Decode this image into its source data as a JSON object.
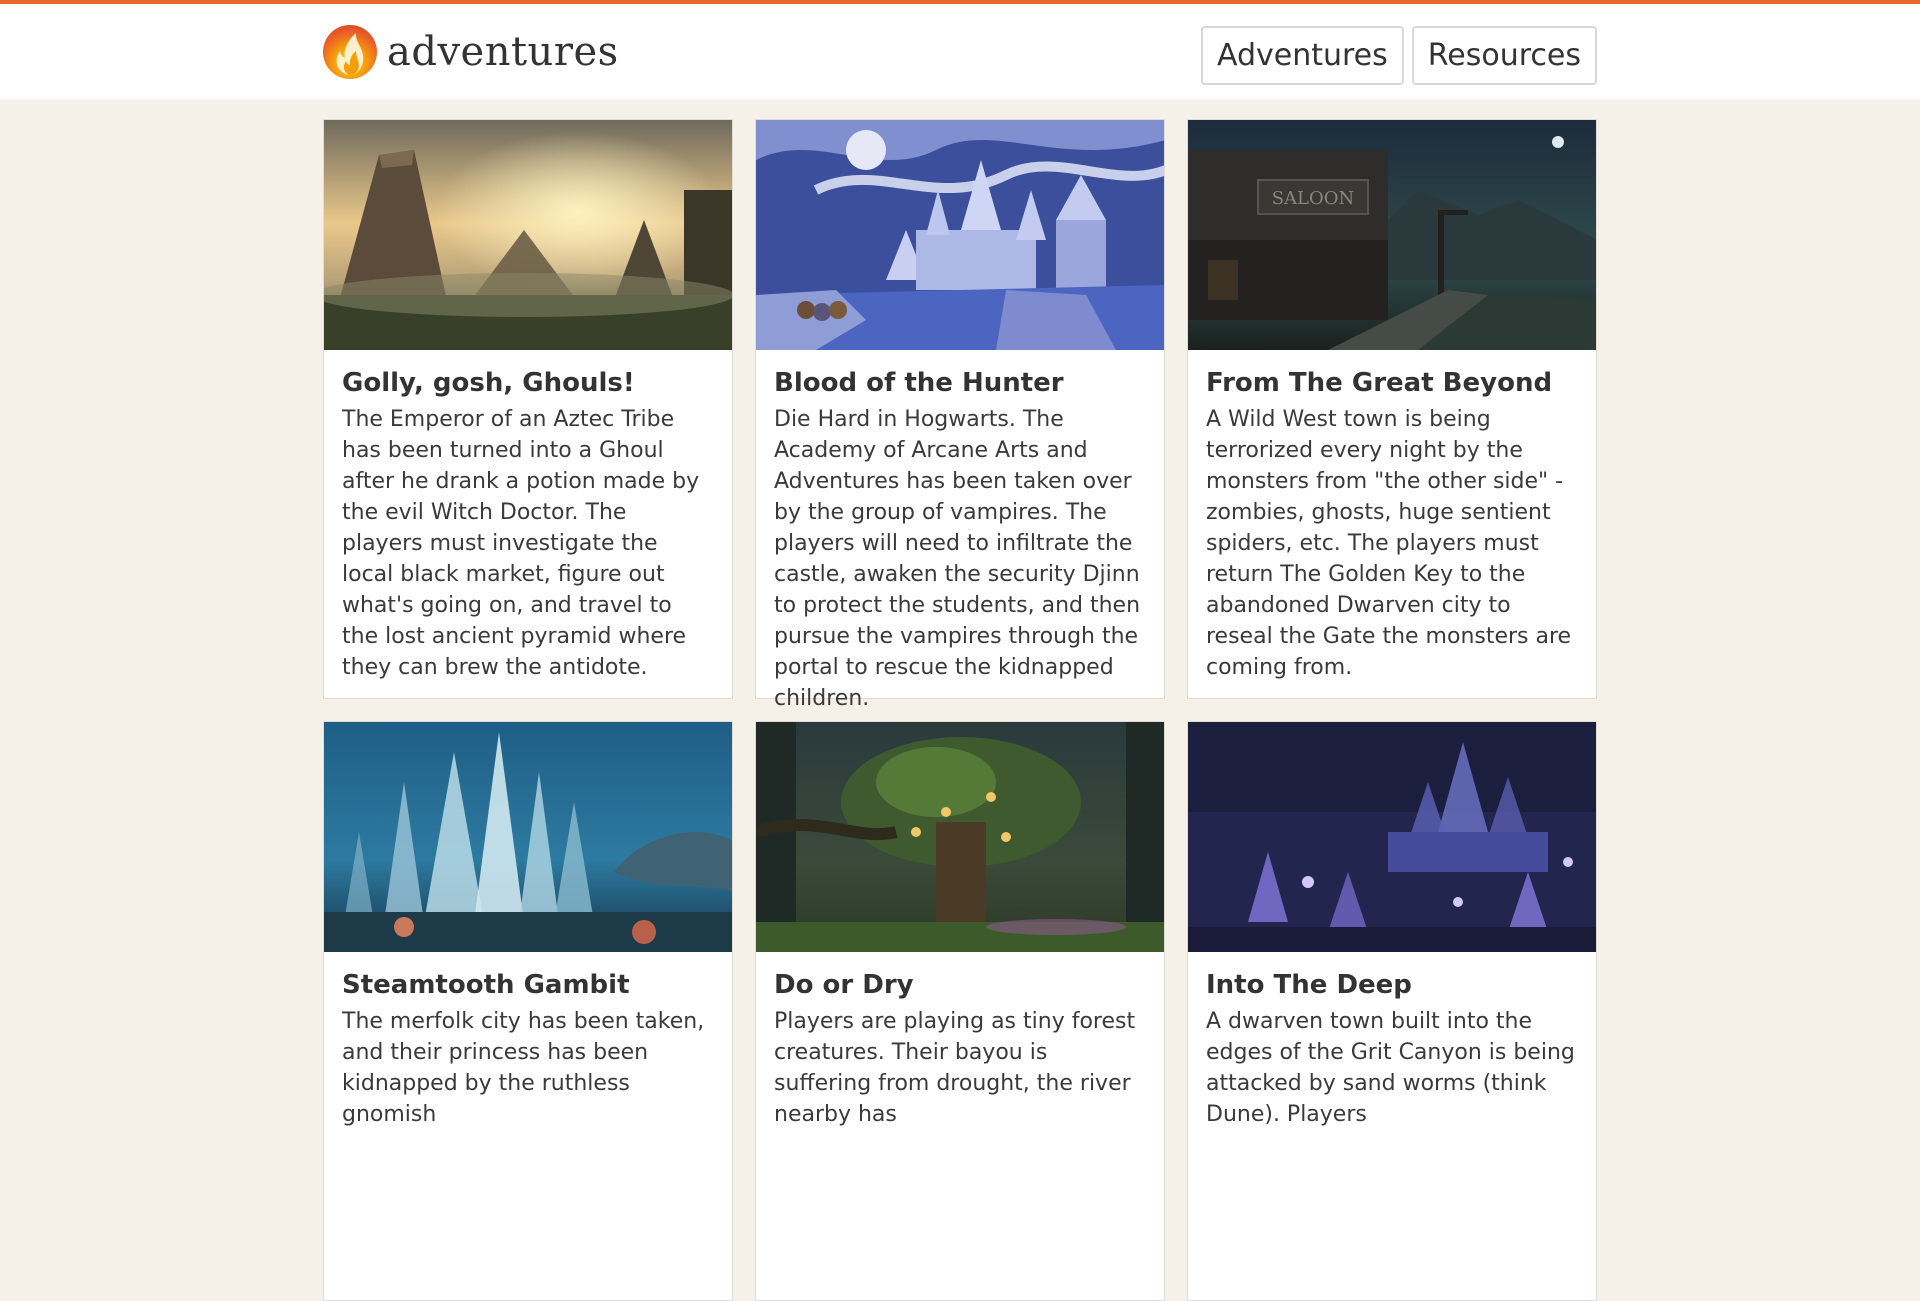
{
  "header": {
    "brand": "adventures",
    "nav": [
      "Adventures",
      "Resources"
    ]
  },
  "colors": {
    "accent": "#e8672a",
    "background": "#f6f1e8"
  },
  "cards": [
    {
      "title": "Golly, gosh, Ghouls!",
      "description": "The Emperor of an Aztec Tribe has been turned into a Ghoul after he drank a potion made by the evil Witch Doctor. The players must investigate the local black market, figure out what's going on, and travel to the lost ancient pyramid where they can brew the antidote."
    },
    {
      "title": "Blood of the Hunter",
      "description": "Die Hard in Hogwarts. The Academy of Arcane Arts and Adventures has been taken over by the group of vampires. The players will need to infiltrate the castle, awaken the security Djinn to protect the students, and then pursue the vampires through the portal to rescue the kidnapped children."
    },
    {
      "title": "From The Great Beyond",
      "description": "A Wild West town is being terrorized every night by the monsters from \"the other side\" - zombies, ghosts, huge sentient spiders, etc. The players must return The Golden Key to the abandoned Dwarven city to reseal the Gate the monsters are coming from."
    },
    {
      "title": "Steamtooth Gambit",
      "description": "The merfolk city has been taken, and their princess has been kidnapped by the ruthless gnomish"
    },
    {
      "title": "Do or Dry",
      "description": "Players are playing as tiny forest creatures. Their bayou is suffering from drought, the river nearby has"
    },
    {
      "title": "Into The Deep",
      "description": "A dwarven town built into the edges of the Grit Canyon is being attacked by sand worms (think Dune). Players"
    }
  ]
}
